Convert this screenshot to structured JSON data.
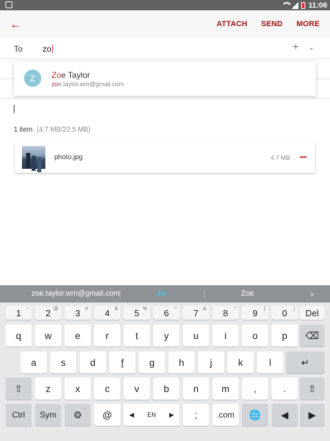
{
  "status_bar": {
    "time": "11:06"
  },
  "toolbar": {
    "back_icon": "arrow-left-icon",
    "attach": "ATTACH",
    "send": "SEND",
    "more": "MORE"
  },
  "to_field": {
    "label": "To",
    "value": "zo"
  },
  "suggestion": {
    "avatar_letter": "Z",
    "name_match": "Zo",
    "name_rest": "e Taylor",
    "email_match": "zo",
    "email_rest": "e.taylor.wm@gmail.com"
  },
  "attachments": {
    "count_label": "1 item",
    "size_info": "(4.7 MB/22.5 MB)",
    "items": [
      {
        "name": "photo.jpg",
        "size": "4.7 MB"
      }
    ]
  },
  "keyboard": {
    "predictions": [
      "zoe.taylor.wm@gmail.com",
      "zo",
      "Zoe"
    ],
    "number_row": [
      "1",
      "2",
      "3",
      "4",
      "5",
      "6",
      "7",
      "8",
      "9",
      "0"
    ],
    "number_row_alt": [
      "~",
      "@",
      "#",
      "$",
      "%",
      "^",
      "&",
      "*",
      "(",
      ")"
    ],
    "row1": [
      "q",
      "w",
      "e",
      "r",
      "t",
      "y",
      "u",
      "i",
      "o",
      "p"
    ],
    "row2": [
      "a",
      "s",
      "d",
      "f",
      "g",
      "h",
      "j",
      "k",
      "l"
    ],
    "row3": [
      "z",
      "x",
      "c",
      "v",
      "b",
      "n",
      "m",
      ",",
      "."
    ],
    "del_label": "Del",
    "ctrl_label": "Ctrl",
    "sym_label": "Sym",
    "at_label": "@",
    "lang_label": "EN",
    "semicolon_label": ";",
    "dotcom_label": ".com"
  },
  "colors": {
    "accent": "#a11616",
    "prediction_active": "#42c4f4"
  }
}
